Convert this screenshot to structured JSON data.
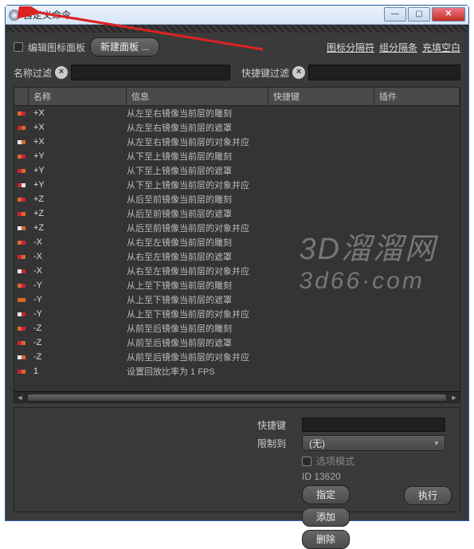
{
  "window": {
    "title": "自定义命令..."
  },
  "toolbar": {
    "edit_palette_label": "编辑图标面板",
    "new_panel_label": "新建面板 ...",
    "icon_separator": "图标分隔符",
    "group_separator": "组分隔条",
    "fill_blank": "充填空白"
  },
  "filters": {
    "name_label": "名称过滤",
    "name_value": "",
    "shortcut_label": "快捷键过滤",
    "shortcut_value": ""
  },
  "columns": {
    "name": "名称",
    "info": "信息",
    "shortcut": "快捷键",
    "plugin": "插件"
  },
  "rows": [
    {
      "name": "+X",
      "info": "从左至右镜像当前层的雕刻"
    },
    {
      "name": "+X",
      "info": "从左至右镜像当前层的遮罩"
    },
    {
      "name": "+X",
      "info": "从左至右镜像当前层的对象并应"
    },
    {
      "name": "+Y",
      "info": "从下至上镜像当前层的雕刻"
    },
    {
      "name": "+Y",
      "info": "从下至上镜像当前层的遮罩"
    },
    {
      "name": "+Y",
      "info": "从下至上镜像当前层的对象并应"
    },
    {
      "name": "+Z",
      "info": "从后至前镜像当前层的雕刻"
    },
    {
      "name": "+Z",
      "info": "从后至前镜像当前层的遮罩"
    },
    {
      "name": "+Z",
      "info": "从后至前镜像当前层的对象并应"
    },
    {
      "name": "-X",
      "info": "从右至左镜像当前层的雕刻"
    },
    {
      "name": "-X",
      "info": "从右至左镜像当前层的遮罩"
    },
    {
      "name": "-X",
      "info": "从右至左镜像当前层的对象并应"
    },
    {
      "name": "-Y",
      "info": "从上至下镜像当前层的雕刻"
    },
    {
      "name": "-Y",
      "info": "从上至下镜像当前层的遮罩"
    },
    {
      "name": "-Y",
      "info": "从上至下镜像当前层的对象并应"
    },
    {
      "name": "-Z",
      "info": "从前至后镜像当前层的雕刻"
    },
    {
      "name": "-Z",
      "info": "从前至后镜像当前层的遮罩"
    },
    {
      "name": "-Z",
      "info": "从前至后镜像当前层的对象并应"
    },
    {
      "name": "1",
      "info": "设置回放比率为 1 FPS"
    }
  ],
  "icons": {
    "colors": {
      "orange": "#d86a2a",
      "red": "#c23",
      "white": "#e8e8e8"
    },
    "pattern": [
      [
        "o",
        "r"
      ],
      [
        "r",
        "o"
      ],
      [
        "w",
        "o"
      ],
      [
        "o",
        "r"
      ],
      [
        "r",
        "o"
      ],
      [
        "r",
        "w"
      ],
      [
        "o",
        "r"
      ],
      [
        "r",
        "o"
      ],
      [
        "w",
        "o"
      ],
      [
        "o",
        "r"
      ],
      [
        "r",
        "o"
      ],
      [
        "w",
        "r"
      ],
      [
        "o",
        "r"
      ],
      [
        "o",
        "o"
      ],
      [
        "w",
        "r"
      ],
      [
        "o",
        "r"
      ],
      [
        "r",
        "o"
      ],
      [
        "w",
        "o"
      ],
      [
        "r",
        "o"
      ]
    ]
  },
  "form": {
    "shortcut_label": "快捷键",
    "shortcut_value": "",
    "limit_label": "限制到",
    "limit_value": "(无)",
    "option_mode_label": "选项模式",
    "id_label": "ID 13620",
    "assign": "指定",
    "add": "添加",
    "delete": "删除",
    "execute": "执行"
  },
  "watermark": {
    "l1": "3D溜溜网",
    "l2": "3d66·com"
  }
}
